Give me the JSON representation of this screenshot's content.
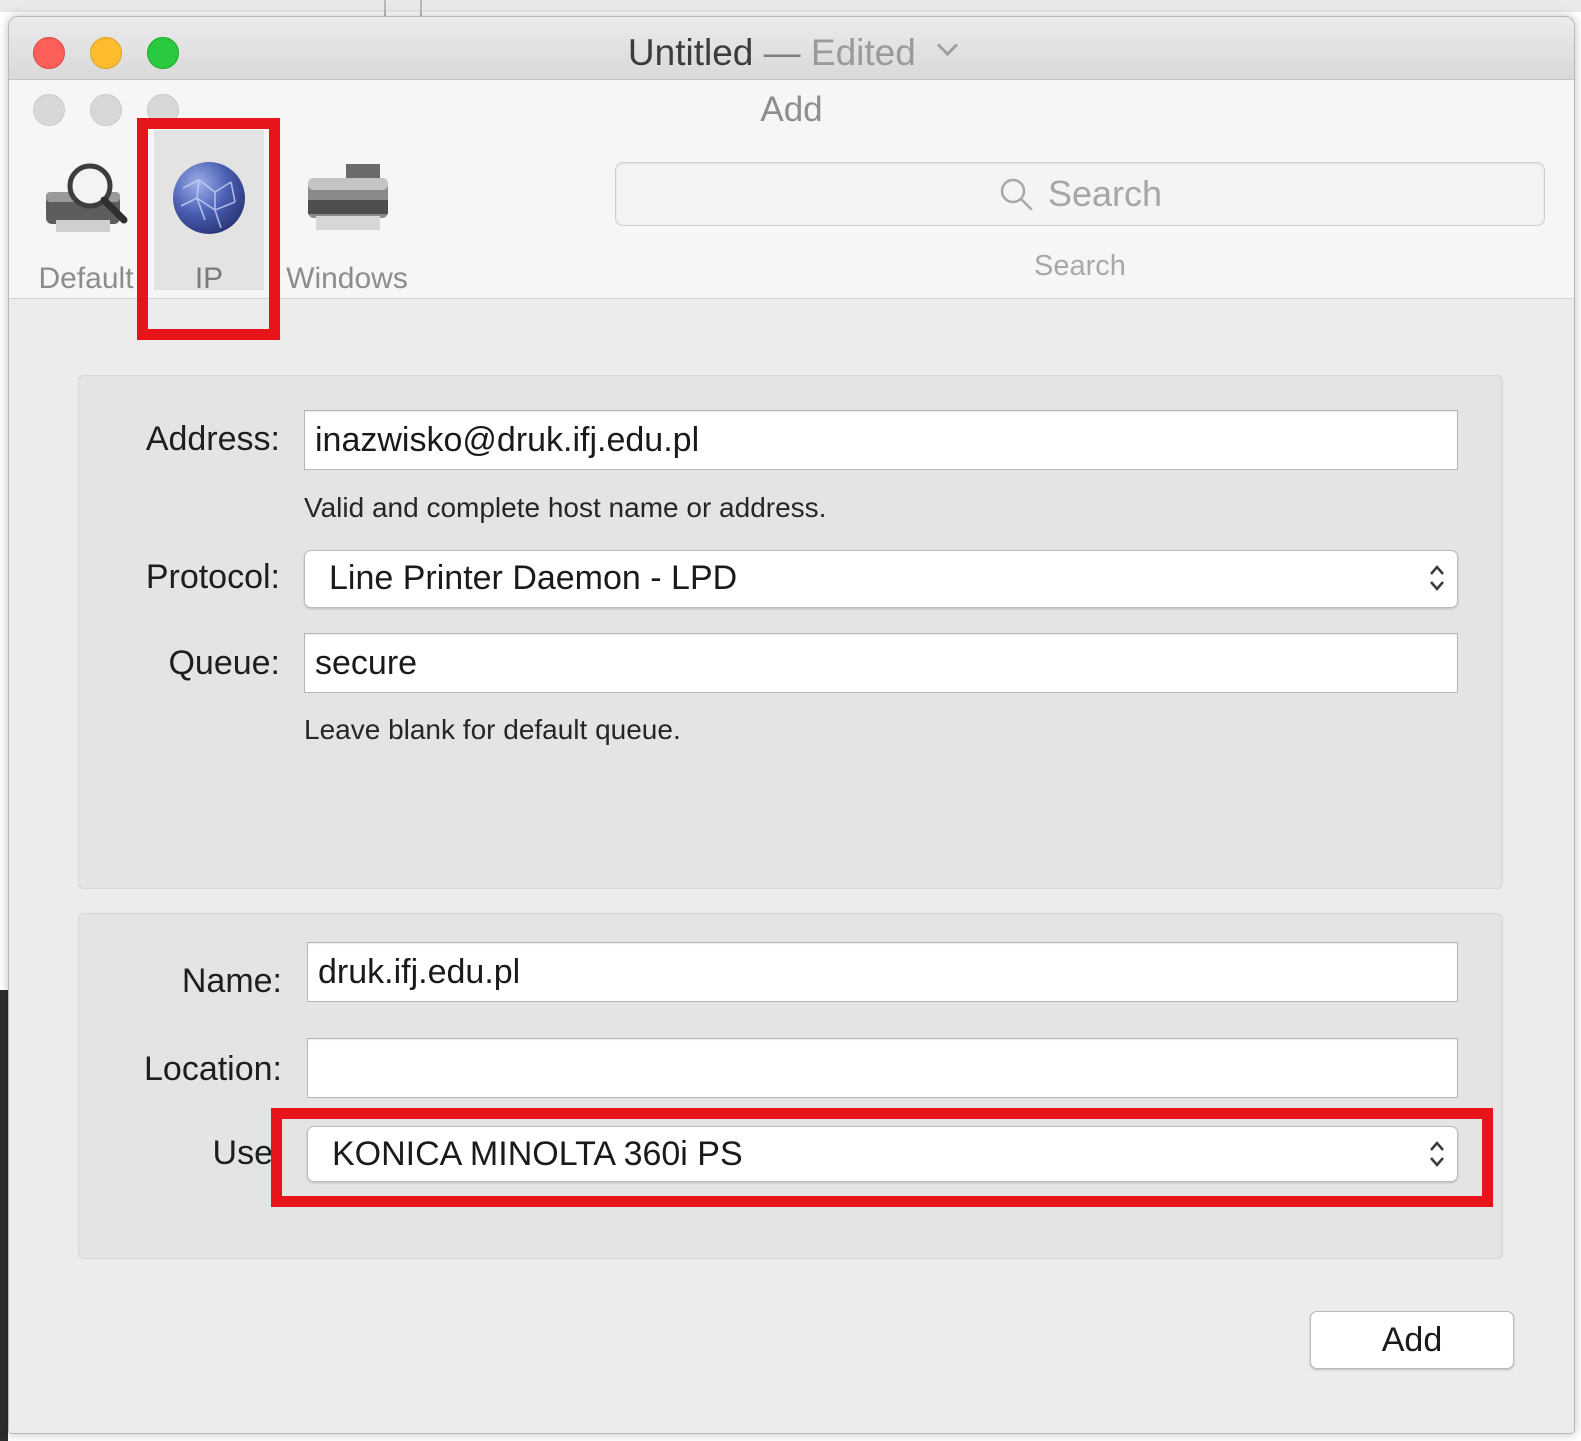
{
  "window": {
    "title": "Untitled",
    "title_separator": "—",
    "title_state": "Edited"
  },
  "sheet": {
    "title": "Add"
  },
  "toolbar": {
    "items": [
      {
        "label": "Default",
        "icon": "default-printer-icon",
        "selected": false
      },
      {
        "label": "IP",
        "icon": "globe-icon",
        "selected": true
      },
      {
        "label": "Windows",
        "icon": "windows-printer-icon",
        "selected": false
      }
    ],
    "search": {
      "placeholder": "Search",
      "caption": "Search"
    }
  },
  "ip_panel": {
    "address_label": "Address:",
    "address_value": "inazwisko@druk.ifj.edu.pl",
    "address_hint": "Valid and complete host name or address.",
    "protocol_label": "Protocol:",
    "protocol_value": "Line Printer Daemon - LPD",
    "queue_label": "Queue:",
    "queue_value": "secure",
    "queue_hint": "Leave blank for default queue."
  },
  "details_panel": {
    "name_label": "Name:",
    "name_value": "druk.ifj.edu.pl",
    "location_label": "Location:",
    "location_value": "",
    "use_label": "Use",
    "use_value": "KONICA MINOLTA 360i PS"
  },
  "footer": {
    "add_label": "Add"
  },
  "colors": {
    "highlight": "#e8141c",
    "close": "#fc5f57",
    "minimize": "#fdbc2e",
    "zoom": "#29c940"
  }
}
